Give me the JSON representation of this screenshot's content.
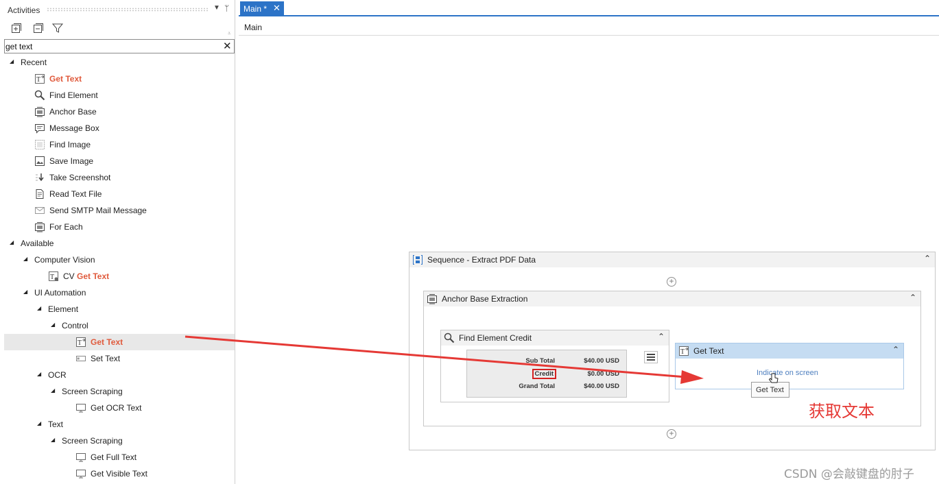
{
  "activities_panel": {
    "title": "Activities",
    "search": {
      "value": "get text",
      "placeholder": ""
    },
    "tree": [
      {
        "label": "Recent",
        "kind": "group"
      },
      {
        "label": "Get Text",
        "highlight": "Get Text",
        "icon": "get-text-icon"
      },
      {
        "label": "Find Element",
        "icon": "magnifier-icon"
      },
      {
        "label": "Anchor Base",
        "icon": "anchor-base-icon"
      },
      {
        "label": "Message Box",
        "icon": "message-box-icon"
      },
      {
        "label": "Find Image",
        "icon": "find-image-icon"
      },
      {
        "label": "Save Image",
        "icon": "save-image-icon"
      },
      {
        "label": "Take Screenshot",
        "icon": "screenshot-icon"
      },
      {
        "label": "Read Text File",
        "icon": "text-file-icon"
      },
      {
        "label": "Send SMTP Mail Message",
        "icon": "mail-icon"
      },
      {
        "label": "For Each",
        "icon": "for-each-icon"
      },
      {
        "label": "Available",
        "kind": "group"
      },
      {
        "label": "Computer Vision",
        "kind": "group"
      },
      {
        "label_prefix": "CV ",
        "highlight": "Get Text",
        "icon": "cv-get-text-icon"
      },
      {
        "label": "UI Automation",
        "kind": "group"
      },
      {
        "label": "Element",
        "kind": "group"
      },
      {
        "label": "Control",
        "kind": "group"
      },
      {
        "label": "Get Text",
        "highlight": "Get Text",
        "icon": "get-text-icon"
      },
      {
        "label": "Set Text",
        "icon": "set-text-icon"
      },
      {
        "label": "OCR",
        "kind": "group"
      },
      {
        "label": "Screen Scraping",
        "kind": "group"
      },
      {
        "label": "Get OCR Text",
        "icon": "monitor-icon"
      },
      {
        "label": "Text",
        "kind": "group"
      },
      {
        "label": "Screen Scraping",
        "kind": "group"
      },
      {
        "label": "Get Full Text",
        "icon": "monitor-icon"
      },
      {
        "label": "Get Visible Text",
        "icon": "monitor-icon"
      }
    ]
  },
  "designer": {
    "tab_label": "Main *",
    "breadcrumb": "Main",
    "sequence": {
      "title": "Sequence - Extract PDF Data"
    },
    "anchor_base": {
      "title": "Anchor Base Extraction"
    },
    "find_element": {
      "title": "Find Element Credit",
      "thumbnail_rows": [
        {
          "label": "Sub Total",
          "value": "$40.00 USD"
        },
        {
          "label": "Credit",
          "value": "$0.00 USD"
        },
        {
          "label": "Grand Total",
          "value": "$40.00 USD"
        }
      ]
    },
    "get_text": {
      "title": "Get Text",
      "indicate_link": "Indicate on screen",
      "tooltip": "Get Text"
    }
  },
  "annotation_text": "获取文本",
  "watermark": "CSDN @会敲键盘的肘子",
  "colors": {
    "accent_blue": "#2c73c7",
    "highlight_orange": "#e05a3c",
    "arrow_red": "#e53935"
  }
}
